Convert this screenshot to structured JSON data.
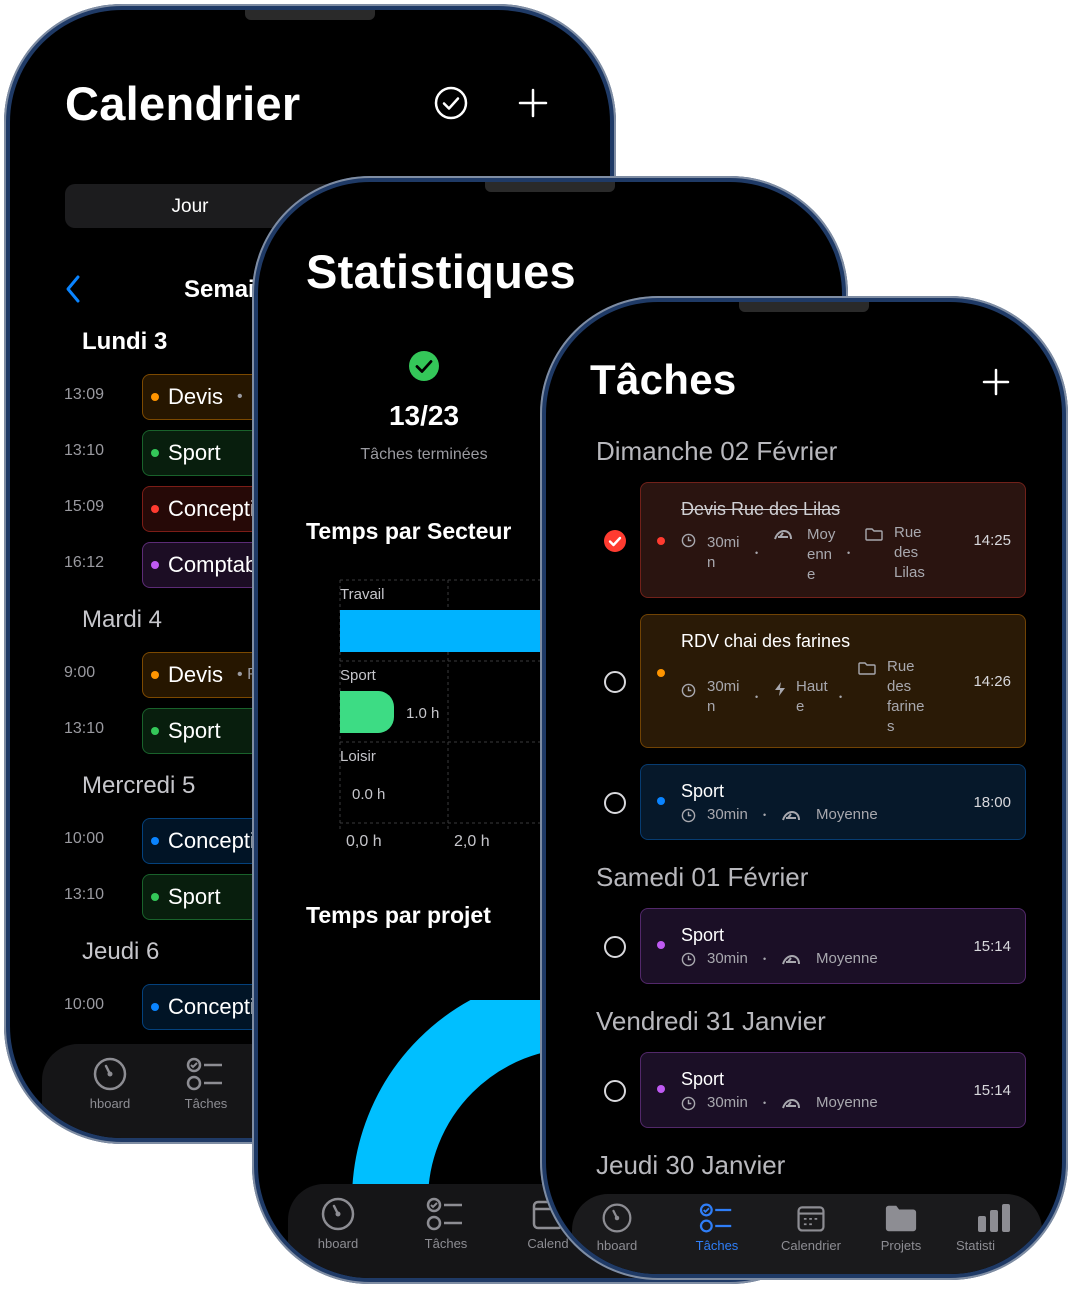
{
  "calendar": {
    "title": "Calendrier",
    "segment_day": "Jour",
    "week_label": "Semai",
    "days": [
      {
        "label": "Lundi 3",
        "events": [
          {
            "time": "13:09",
            "title": "Devis",
            "extra": "•",
            "color": "#ff9500"
          },
          {
            "time": "13:10",
            "title": "Sport",
            "extra": "",
            "color": "#34c759"
          },
          {
            "time": "15:09",
            "title": "Concepti",
            "extra": "",
            "color": "#ff3b30"
          },
          {
            "time": "16:12",
            "title": "Comptab",
            "extra": "",
            "color": "#bf5af2"
          }
        ]
      },
      {
        "label": "Mardi 4",
        "events": [
          {
            "time": "9:00",
            "title": "Devis",
            "extra": "• R",
            "color": "#ff9500"
          },
          {
            "time": "13:10",
            "title": "Sport",
            "extra": "",
            "color": "#34c759"
          }
        ]
      },
      {
        "label": "Mercredi 5",
        "events": [
          {
            "time": "10:00",
            "title": "Concepti",
            "extra": "",
            "color": "#0a84ff"
          },
          {
            "time": "13:10",
            "title": "Sport",
            "extra": "",
            "color": "#34c759"
          }
        ]
      },
      {
        "label": "Jeudi 6",
        "events": [
          {
            "time": "10:00",
            "title": "Concepti",
            "extra": "",
            "color": "#0a84ff"
          }
        ]
      }
    ],
    "tabs": [
      "hboard",
      "Tâches"
    ]
  },
  "stats": {
    "title": "Statistiques",
    "done_count": "13/23",
    "done_label": "Tâches terminées",
    "sector_title": "Temps par Secteur",
    "project_title": "Temps par projet",
    "tabs": [
      "hboard",
      "Tâches",
      "Calend"
    ]
  },
  "chart_data": {
    "type": "bar",
    "orientation": "horizontal",
    "title": "Temps par Secteur",
    "categories": [
      "Travail",
      "Sport",
      "Loisir"
    ],
    "values": [
      null,
      1.0,
      0.0
    ],
    "value_labels": [
      "",
      "1.0 h",
      "0.0 h"
    ],
    "tick_labels": [
      "0,0 h",
      "2,0 h"
    ],
    "colors": [
      "#00b3ff",
      "#3ddc84",
      "#3ddc84"
    ],
    "grid": true
  },
  "tasks": {
    "title": "Tâches",
    "sections": [
      {
        "label": "Dimanche 02 Février",
        "items": [
          {
            "title": "Devis Rue des Lilas",
            "done": true,
            "dot": "#ff3b30",
            "duration": "30mi\nn",
            "priority": "Moy\nenn\ne",
            "location": "Rue\ndes\nLilas",
            "time": "14:25"
          },
          {
            "title": "RDV chai des farines",
            "done": false,
            "dot": "#ff9500",
            "duration": "30mi\nn",
            "priority": "Haut\ne",
            "location": "Rue\ndes\nfarine\ns",
            "time": "14:26"
          },
          {
            "title": "Sport",
            "done": false,
            "dot": "#0a84ff",
            "duration": "30min",
            "priority": "Moyenne",
            "location": "",
            "time": "18:00"
          }
        ]
      },
      {
        "label": "Samedi 01 Février",
        "items": [
          {
            "title": "Sport",
            "done": false,
            "dot": "#bf5af2",
            "duration": "30min",
            "priority": "Moyenne",
            "location": "",
            "time": "15:14"
          }
        ]
      },
      {
        "label": "Vendredi 31 Janvier",
        "items": [
          {
            "title": "Sport",
            "done": false,
            "dot": "#bf5af2",
            "duration": "30min",
            "priority": "Moyenne",
            "location": "",
            "time": "15:14"
          }
        ]
      },
      {
        "label": "Jeudi 30 Janvier",
        "items": []
      }
    ],
    "tabs": [
      "hboard",
      "Tâches",
      "Calendrier",
      "Projets",
      "Statisti"
    ],
    "active_tab": "Tâches"
  }
}
